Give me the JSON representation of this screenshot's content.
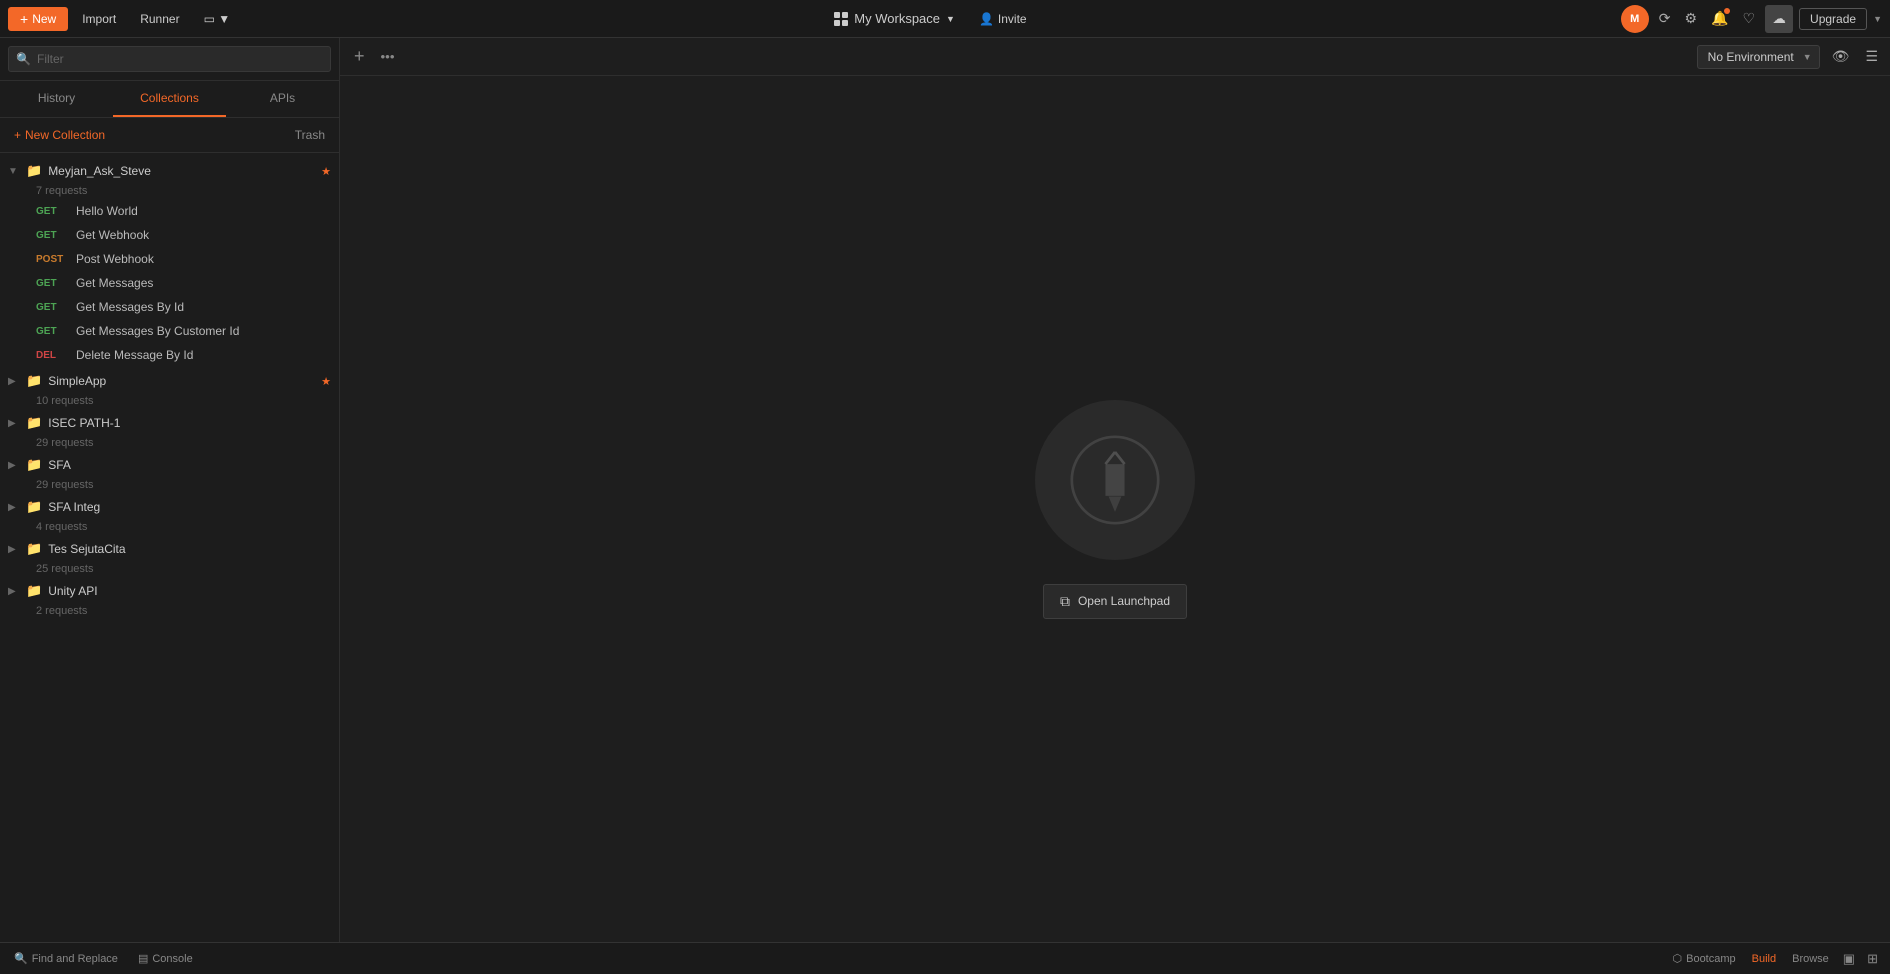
{
  "topbar": {
    "new_label": "New",
    "import_label": "Import",
    "runner_label": "Runner",
    "workspace_label": "My Workspace",
    "invite_label": "Invite",
    "upgrade_label": "Upgrade"
  },
  "sidebar": {
    "search_placeholder": "Filter",
    "tabs": [
      {
        "id": "history",
        "label": "History"
      },
      {
        "id": "collections",
        "label": "Collections"
      },
      {
        "id": "apis",
        "label": "APIs"
      }
    ],
    "active_tab": "collections",
    "new_collection_label": "New Collection",
    "trash_label": "Trash",
    "collections": [
      {
        "id": "meyjan",
        "name": "Meyjan_Ask_Steve",
        "starred": true,
        "requests_count": "7 requests",
        "expanded": true,
        "requests": [
          {
            "method": "GET",
            "name": "Hello World"
          },
          {
            "method": "GET",
            "name": "Get Webhook"
          },
          {
            "method": "POST",
            "name": "Post Webhook"
          },
          {
            "method": "GET",
            "name": "Get Messages"
          },
          {
            "method": "GET",
            "name": "Get Messages By Id"
          },
          {
            "method": "GET",
            "name": "Get Messages By Customer Id"
          },
          {
            "method": "DEL",
            "name": "Delete Message By Id"
          }
        ]
      },
      {
        "id": "simpleapp",
        "name": "SimpleApp",
        "starred": true,
        "requests_count": "10 requests",
        "expanded": false,
        "requests": []
      },
      {
        "id": "isec",
        "name": "ISEC PATH-1",
        "starred": false,
        "requests_count": "29 requests",
        "expanded": false,
        "requests": []
      },
      {
        "id": "sfa",
        "name": "SFA",
        "starred": false,
        "requests_count": "29 requests",
        "expanded": false,
        "requests": []
      },
      {
        "id": "sfa-integ",
        "name": "SFA Integ",
        "starred": false,
        "requests_count": "4 requests",
        "expanded": false,
        "requests": []
      },
      {
        "id": "tes-sejuta",
        "name": "Tes SejutaCita",
        "starred": false,
        "requests_count": "25 requests",
        "expanded": false,
        "requests": []
      },
      {
        "id": "unity-api",
        "name": "Unity API",
        "starred": false,
        "requests_count": "2 requests",
        "expanded": false,
        "requests": []
      }
    ]
  },
  "tabbar": {
    "environment_label": "No Environment"
  },
  "empty_state": {
    "open_launchpad_label": "Open Launchpad"
  },
  "bottombar": {
    "find_replace_label": "Find and Replace",
    "console_label": "Console",
    "bootcamp_label": "Bootcamp",
    "build_label": "Build",
    "browse_label": "Browse"
  }
}
